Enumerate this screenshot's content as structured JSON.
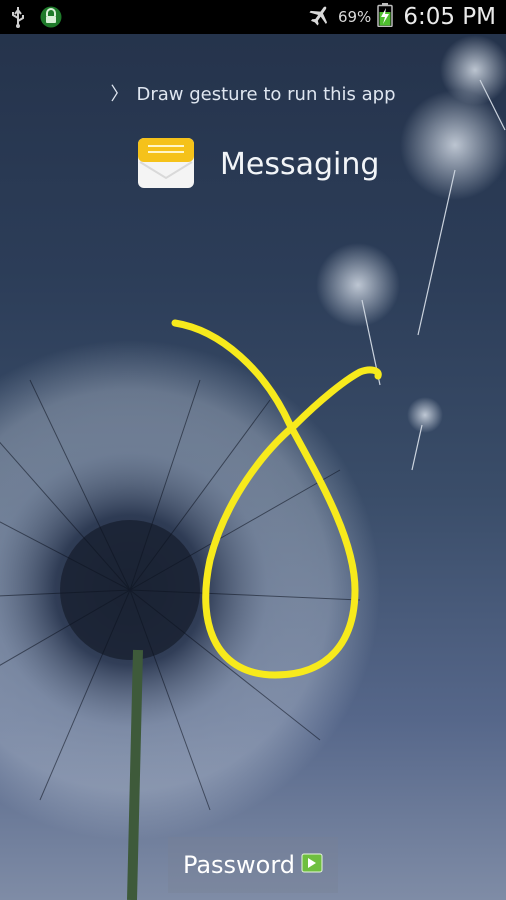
{
  "status_bar": {
    "icons_left": [
      "usb-icon",
      "lock-icon"
    ],
    "icons_right": [
      "airplane-mode-icon",
      "battery-charging-icon"
    ],
    "battery_percent": "69%",
    "battery_level": 0.69,
    "time": "6:05 PM"
  },
  "lockscreen": {
    "hint": "Draw gesture to run this app",
    "app_name": "Messaging",
    "app_icon": "messaging-envelope-icon",
    "gesture_color": "#f7ea1c"
  },
  "password_button": {
    "label": "Password",
    "icon": "arrow-right-icon"
  }
}
